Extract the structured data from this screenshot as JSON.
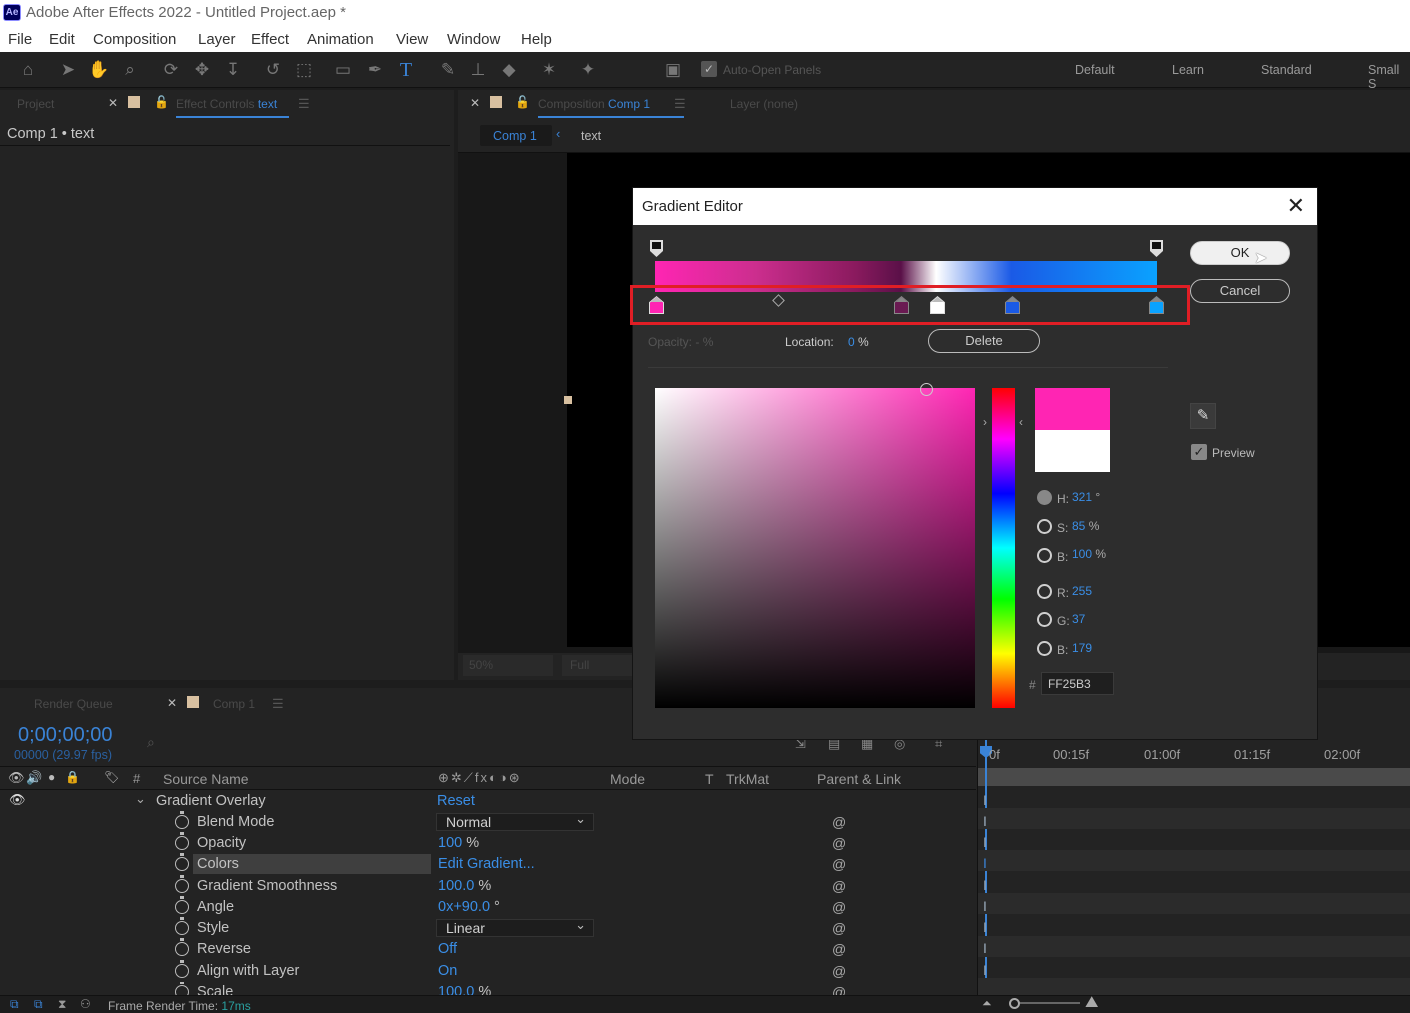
{
  "window": {
    "app_icon": "Ae",
    "title": "Adobe After Effects 2022 - Untitled Project.aep *"
  },
  "menu": [
    "File",
    "Edit",
    "Composition",
    "Layer",
    "Effect",
    "Animation",
    "View",
    "Window",
    "Help"
  ],
  "toolbar": {
    "auto_open": "Auto-Open Panels",
    "workspaces": [
      "Default",
      "Learn",
      "Standard",
      "Small S"
    ]
  },
  "left_panel": {
    "tab_project": "Project",
    "tab_effect_prefix": "Effect Controls",
    "tab_effect_layer": "text",
    "subtitle": "Comp 1 • text"
  },
  "comp_panel": {
    "tab_prefix": "Composition",
    "tab_name": "Comp 1",
    "layer_tab": "Layer (none)",
    "crumb_comp": "Comp 1",
    "crumb_layer": "text",
    "zoom": "50%",
    "resolution": "Full"
  },
  "dialog": {
    "title": "Gradient Editor",
    "ok": "OK",
    "cancel": "Cancel",
    "delete": "Delete",
    "opacity_label": "Opacity:",
    "opacity_value": "-",
    "opacity_unit": "%",
    "location_label": "Location:",
    "location_value": "0",
    "location_unit": "%",
    "preview_label": "Preview",
    "hsb": {
      "h_label": "H:",
      "h_value": "321",
      "h_unit": "°",
      "s_label": "S:",
      "s_value": "85",
      "s_unit": "%",
      "b_label": "B:",
      "b_value": "100",
      "b_unit": "%"
    },
    "rgb": {
      "r_label": "R:",
      "r_value": "255",
      "g_label": "G:",
      "g_value": "37",
      "b_label": "B:",
      "b_value": "179"
    },
    "hex_label": "#",
    "hex_value": "FF25B3",
    "colors": {
      "new": "#ff25b3",
      "old": "#ffffff"
    }
  },
  "timeline": {
    "tab_render": "Render Queue",
    "tab_comp": "Comp 1",
    "timecode": "0;00;00;00",
    "frames": "00000 (29.97 fps)",
    "headers": {
      "hash": "#",
      "source": "Source Name",
      "mode": "Mode",
      "t": "T",
      "trkmat": "TrkMat",
      "parent": "Parent & Link"
    },
    "ruler": [
      "0f",
      "00:15f",
      "01:00f",
      "01:15f",
      "02:00f"
    ],
    "effect": {
      "name": "Gradient Overlay",
      "reset": "Reset"
    },
    "props": [
      {
        "name": "Blend Mode",
        "value": "Normal",
        "unit": ""
      },
      {
        "name": "Opacity",
        "value": "100",
        "unit": " %"
      },
      {
        "name": "Colors",
        "value": "Edit Gradient...",
        "unit": ""
      },
      {
        "name": "Gradient Smoothness",
        "value": "100.0",
        "unit": " %"
      },
      {
        "name": "Angle",
        "value": "0x+90.0",
        "unit": " °"
      },
      {
        "name": "Style",
        "value": "Linear",
        "unit": ""
      },
      {
        "name": "Reverse",
        "value": "Off",
        "unit": ""
      },
      {
        "name": "Align with Layer",
        "value": "On",
        "unit": ""
      },
      {
        "name": "Scale",
        "value": "100.0",
        "unit": " %"
      }
    ],
    "status_label": "Frame Render Time:",
    "status_value": "17ms"
  }
}
